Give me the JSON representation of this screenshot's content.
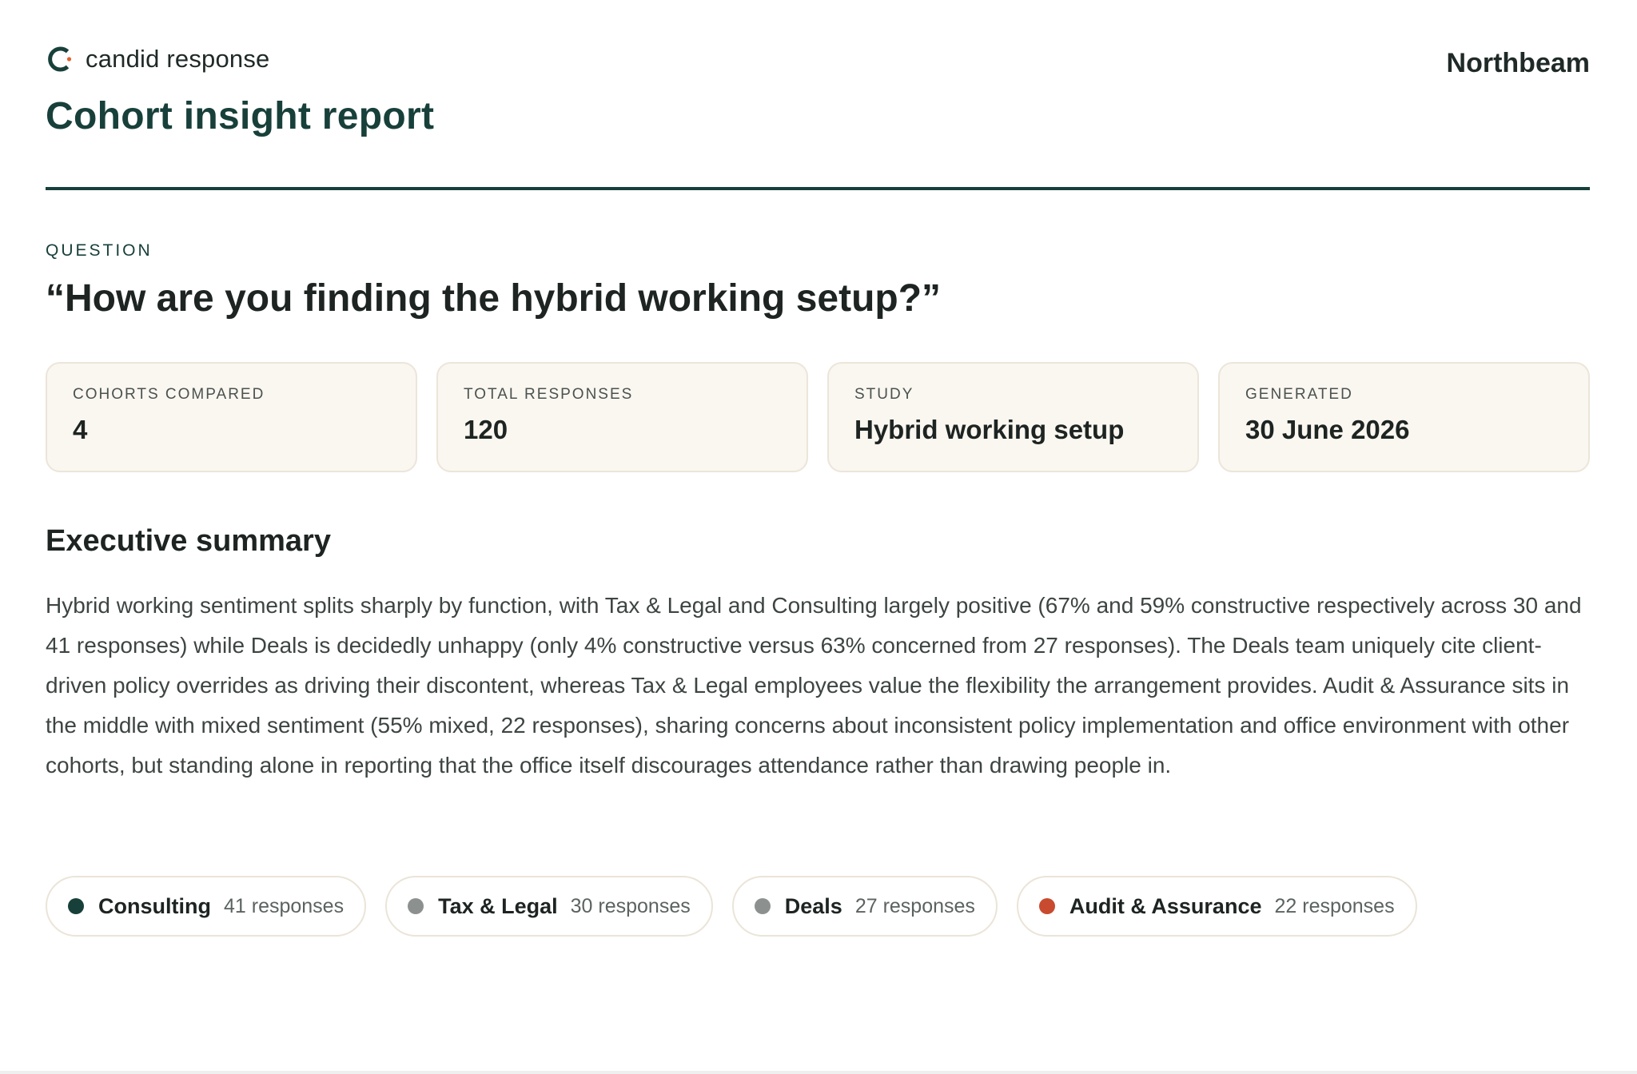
{
  "brand": {
    "name": "candid response",
    "icon": "brand-ring-icon"
  },
  "report": {
    "title": "Cohort insight report",
    "client": "Northbeam"
  },
  "question": {
    "label": "QUESTION",
    "text": "“How are you finding the hybrid working setup?”"
  },
  "stats": [
    {
      "label": "COHORTS COMPARED",
      "value": "4"
    },
    {
      "label": "TOTAL RESPONSES",
      "value": "120"
    },
    {
      "label": "STUDY",
      "value": "Hybrid working setup"
    },
    {
      "label": "GENERATED",
      "value": "30 June 2026"
    }
  ],
  "summary": {
    "heading": "Executive summary",
    "body": "Hybrid working sentiment splits sharply by function, with Tax & Legal and Consulting largely positive (67% and 59% constructive respectively across 30 and 41 responses) while Deals is decidedly unhappy (only 4% constructive versus 63% concerned from 27 responses). The Deals team uniquely cite client-driven policy overrides as driving their discontent, whereas Tax & Legal employees value the flexibility the arrangement provides. Audit & Assurance sits in the middle with mixed sentiment (55% mixed, 22 responses), sharing concerns about inconsistent policy implementation and office environment with other cohorts, but standing alone in reporting that the office itself discourages attendance rather than drawing people in."
  },
  "cohorts": [
    {
      "name": "Consulting",
      "count": "41 responses",
      "color": "#18403a"
    },
    {
      "name": "Tax & Legal",
      "count": "30 responses",
      "color": "#8c9190"
    },
    {
      "name": "Deals",
      "count": "27 responses",
      "color": "#8c9190"
    },
    {
      "name": "Audit & Assurance",
      "count": "22 responses",
      "color": "#c84b2f"
    }
  ],
  "colors": {
    "accent": "#18403a",
    "brand_orange": "#e0622e",
    "card_bg": "#faf6f0"
  }
}
